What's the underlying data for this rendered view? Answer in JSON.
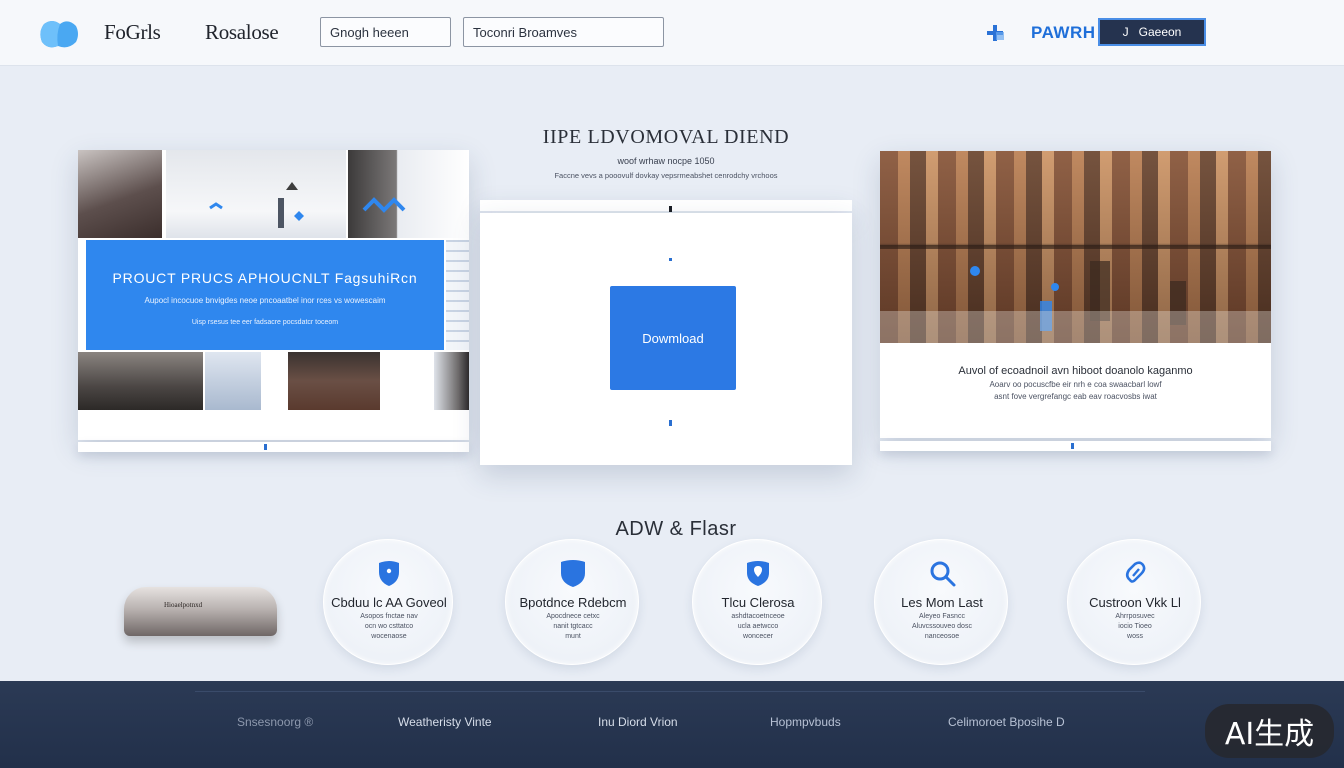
{
  "header": {
    "nav": [
      "FoGrls",
      "Rosalose"
    ],
    "inputs": [
      {
        "value": "",
        "placeholder": "Gnogh heeen"
      },
      {
        "value": "",
        "placeholder": "Toconri Broamves"
      }
    ],
    "brand": "PAWRH",
    "button_icon": "J",
    "button_label": "Gaeeon"
  },
  "colors": {
    "accent": "#2f87ee",
    "header_bg": "#f6f8fb",
    "page_bg": "#e8edf5",
    "footer_bg": "#25334f",
    "brand_text": "#1f6fd9"
  },
  "left_card": {
    "promo_title": "PROUCT PRUCS APHOUCNLT FagsuhiRcn",
    "promo_line1": "Aupocl incocuoe bnvigdes neoe pncoaatbel inor rces vs wowescaim",
    "promo_line2": "Uisp rsesus tee eer fadsacre pocsdatcr toceom"
  },
  "center": {
    "title": "IIPE LDVOMOVAL DIEND",
    "subtitle": "woof wrhaw nocpe 1050",
    "description": "Faccne vevs a pooovulf dovkay vepsrmeabshet cenrodchy vrchoos",
    "download_label": "Dowmload"
  },
  "right_card": {
    "line1": "Auvol of ecoadnoil avn hiboot doanolo kaganmo",
    "line2": "Aoarv oo pocuscfbe eir nrh e coa swaacbarl lowf",
    "line3": "asnt fove vergrefangc eab eav roacvosbs iwat"
  },
  "features": {
    "title": "ADW & Flasr",
    "product_label": "Hioaelpotnxd",
    "items": [
      {
        "icon": "shield-icon",
        "title": "Cbduu lc AA Goveol",
        "lines": [
          "Asopos fnctae nav",
          "ocn wo csttatco",
          "wocenaose"
        ]
      },
      {
        "icon": "shield-icon",
        "title": "Bpotdnce Rdebcm",
        "lines": [
          "Apocdnece cetxc",
          "nanit tgtcacc",
          "munt"
        ]
      },
      {
        "icon": "pin-icon",
        "title": "Tlcu Clerosa",
        "lines": [
          "ashdtacoetnceoe",
          "ucla aetwcco",
          "woncecer"
        ]
      },
      {
        "icon": "search-icon",
        "title": "Les Mom Last",
        "lines": [
          "Aleyeo Fasncc",
          "Aluvcssouveo dosc",
          "nanceosoe"
        ]
      },
      {
        "icon": "link-icon",
        "title": "Custroon Vkk Ll",
        "lines": [
          "Ahrrposuvec",
          "iocio Tioeo",
          "woss"
        ]
      }
    ]
  },
  "footer": {
    "links": [
      "Snsesnoorg  ®",
      "Weatheristy Vinte",
      "Inu  Diord Vrion",
      "Hopmpvbuds",
      "Celimoroet Bposihe  D"
    ]
  },
  "watermark": "AI生成"
}
